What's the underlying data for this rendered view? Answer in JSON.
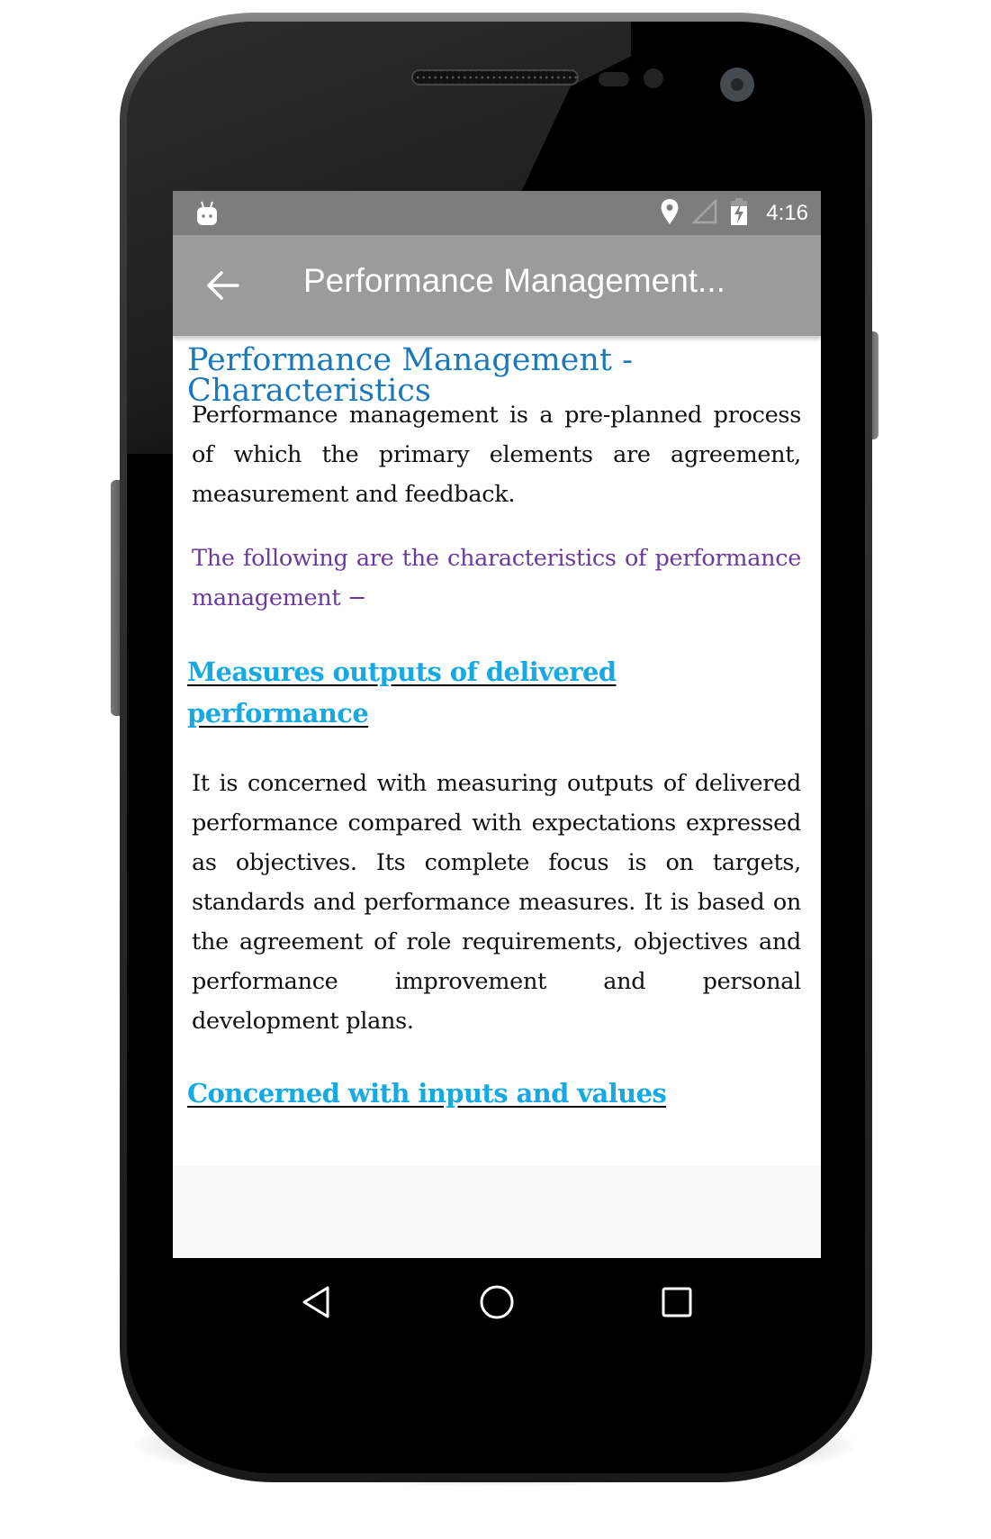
{
  "status_bar": {
    "icons": [
      "android-notification-icon",
      "location-icon",
      "signal-icon",
      "battery-charging-icon"
    ],
    "time": "4:16"
  },
  "app_bar": {
    "back_icon": "arrow-left-icon",
    "title": "Performance Management..."
  },
  "content": {
    "title": "Performance Management - Characteristics",
    "intro": "Performance management is a pre-planned process of which the primary elements are agreement, measurement and feedback.",
    "lead_in": "The following are the characteristics of performance management −",
    "sections": [
      {
        "heading": "Measures outputs of delivered performance",
        "body": "It is concerned with measuring outputs of delivered performance compared with expectations expressed as objectives. Its complete focus is on targets, standards and performance measures. It is based on the agreement of role requirements, objectives and performance improvement and personal development plans."
      },
      {
        "heading": "Concerned with inputs and values"
      }
    ]
  },
  "nav_bar": {
    "back": "nav-back-icon",
    "home": "nav-home-icon",
    "recents": "nav-recents-icon"
  },
  "colors": {
    "title": "#1b79bb",
    "lead_in": "#6b3a9e",
    "section_heading": "#17a9e1",
    "app_bar": "#9b9b9b",
    "status_bar": "#7d7d7d"
  }
}
